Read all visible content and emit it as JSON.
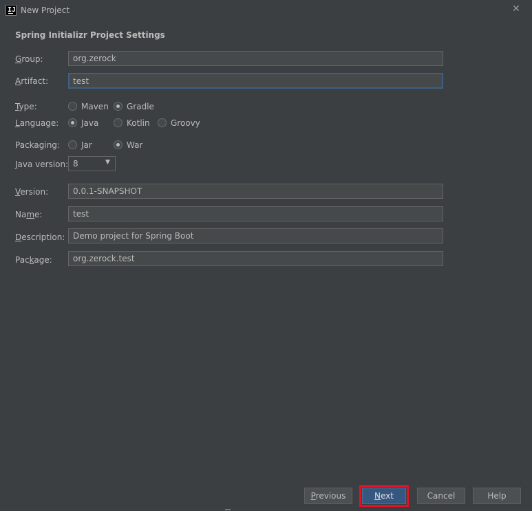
{
  "window": {
    "title": "New Project",
    "app_icon_text": "IJ"
  },
  "section_title": "Spring Initializr Project Settings",
  "fields": {
    "group": {
      "label_ul": "G",
      "label_rest": "roup:",
      "value": "org.zerock"
    },
    "artifact": {
      "label_ul": "A",
      "label_rest": "rtifact:",
      "value": "test"
    },
    "version": {
      "label_ul": "V",
      "label_rest": "ersion:",
      "value": "0.0.1-SNAPSHOT"
    },
    "name": {
      "label_pre": "Na",
      "label_ul": "m",
      "label_rest": "e:",
      "value": "test"
    },
    "description": {
      "label_ul": "D",
      "label_rest": "escription:",
      "value": "Demo project for Spring Boot"
    },
    "package": {
      "label_pre": "Pac",
      "label_ul": "k",
      "label_rest": "age:",
      "value": "org.zerock.test"
    }
  },
  "type": {
    "label_ul": "T",
    "label_rest": "ype:",
    "options": [
      "Maven",
      "Gradle"
    ],
    "selected": "Gradle"
  },
  "language": {
    "label_ul": "L",
    "label_rest": "anguage:",
    "options": [
      "Java",
      "Kotlin",
      "Groovy"
    ],
    "selected": "Java"
  },
  "packaging": {
    "label": "Packaging:",
    "options": [
      "Jar",
      "War"
    ],
    "selected": "War"
  },
  "java_version": {
    "label_ul": "J",
    "label_rest": "ava version:",
    "value": "8"
  },
  "buttons": {
    "previous": {
      "ul": "P",
      "rest": "revious"
    },
    "next": {
      "ul": "N",
      "rest": "ext"
    },
    "cancel": "Cancel",
    "help": "Help"
  },
  "colors": {
    "background": "#3c3f41",
    "field_background": "#45494a",
    "focus_border": "#3d6185",
    "primary_button": "#365880",
    "highlight": "#e3102a"
  }
}
